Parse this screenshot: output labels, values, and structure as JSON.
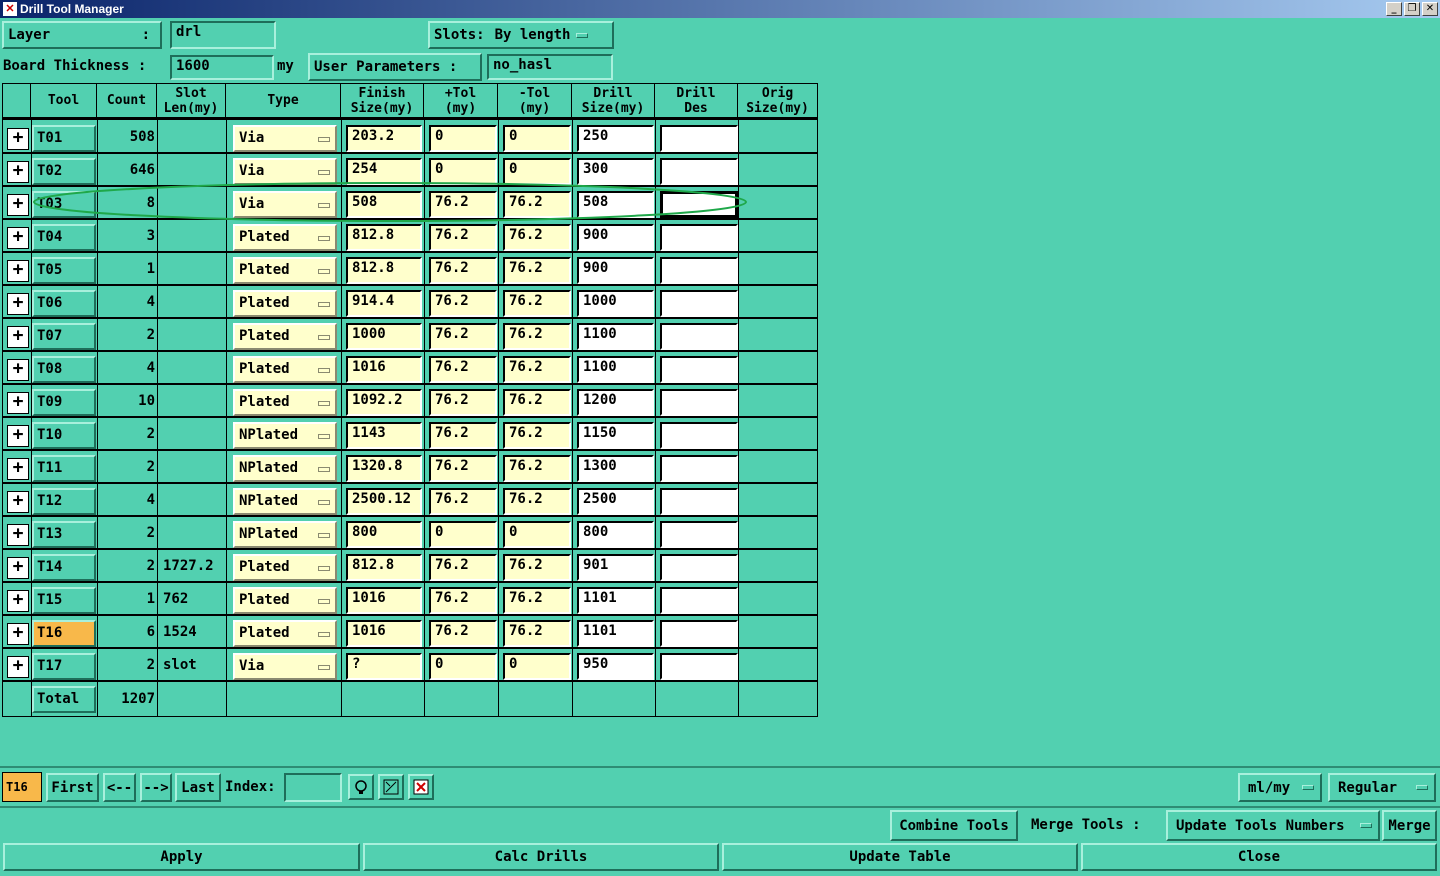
{
  "window": {
    "title": "Drill Tool Manager"
  },
  "top": {
    "layer_label": "Layer",
    "layer_colon": ":",
    "layer_value": "drl",
    "slots_label": "Slots:",
    "slots_value": "By length",
    "board_thickness_label": "Board Thickness :",
    "board_thickness_value": "1600",
    "board_thickness_unit": "my",
    "user_params_label": "User Parameters :",
    "user_params_value": "no_hasl"
  },
  "table": {
    "headers": {
      "tool": "Tool",
      "count": "Count",
      "slot1": "Slot",
      "slot2": "Len(my)",
      "type": "Type",
      "finish1": "Finish",
      "finish2": "Size(my)",
      "ptol1": "+Tol",
      "ptol2": "(my)",
      "mtol1": "-Tol",
      "mtol2": "(my)",
      "drill1": "Drill",
      "drill2": "Size(my)",
      "des1": "Drill",
      "des2": "Des",
      "orig1": "Orig",
      "orig2": "Size(my)"
    },
    "rows": [
      {
        "tool": "T01",
        "count": "508",
        "slot": "",
        "type": "Via",
        "finish": "203.2",
        "ptol": "0",
        "mtol": "0",
        "drill": "250",
        "des": ""
      },
      {
        "tool": "T02",
        "count": "646",
        "slot": "",
        "type": "Via",
        "finish": "254",
        "ptol": "0",
        "mtol": "0",
        "drill": "300",
        "des": ""
      },
      {
        "tool": "T03",
        "count": "8",
        "slot": "",
        "type": "Via",
        "finish": "508",
        "ptol": "76.2",
        "mtol": "76.2",
        "drill": "508",
        "des": ""
      },
      {
        "tool": "T04",
        "count": "3",
        "slot": "",
        "type": "Plated",
        "finish": "812.8",
        "ptol": "76.2",
        "mtol": "76.2",
        "drill": "900",
        "des": ""
      },
      {
        "tool": "T05",
        "count": "1",
        "slot": "",
        "type": "Plated",
        "finish": "812.8",
        "ptol": "76.2",
        "mtol": "76.2",
        "drill": "900",
        "des": ""
      },
      {
        "tool": "T06",
        "count": "4",
        "slot": "",
        "type": "Plated",
        "finish": "914.4",
        "ptol": "76.2",
        "mtol": "76.2",
        "drill": "1000",
        "des": ""
      },
      {
        "tool": "T07",
        "count": "2",
        "slot": "",
        "type": "Plated",
        "finish": "1000",
        "ptol": "76.2",
        "mtol": "76.2",
        "drill": "1100",
        "des": ""
      },
      {
        "tool": "T08",
        "count": "4",
        "slot": "",
        "type": "Plated",
        "finish": "1016",
        "ptol": "76.2",
        "mtol": "76.2",
        "drill": "1100",
        "des": ""
      },
      {
        "tool": "T09",
        "count": "10",
        "slot": "",
        "type": "Plated",
        "finish": "1092.2",
        "ptol": "76.2",
        "mtol": "76.2",
        "drill": "1200",
        "des": ""
      },
      {
        "tool": "T10",
        "count": "2",
        "slot": "",
        "type": "NPlated",
        "finish": "1143",
        "ptol": "76.2",
        "mtol": "76.2",
        "drill": "1150",
        "des": ""
      },
      {
        "tool": "T11",
        "count": "2",
        "slot": "",
        "type": "NPlated",
        "finish": "1320.8",
        "ptol": "76.2",
        "mtol": "76.2",
        "drill": "1300",
        "des": ""
      },
      {
        "tool": "T12",
        "count": "4",
        "slot": "",
        "type": "NPlated",
        "finish": "2500.12",
        "ptol": "76.2",
        "mtol": "76.2",
        "drill": "2500",
        "des": ""
      },
      {
        "tool": "T13",
        "count": "2",
        "slot": "",
        "type": "NPlated",
        "finish": "800",
        "ptol": "0",
        "mtol": "0",
        "drill": "800",
        "des": ""
      },
      {
        "tool": "T14",
        "count": "2",
        "slot": "1727.2",
        "type": "Plated",
        "finish": "812.8",
        "ptol": "76.2",
        "mtol": "76.2",
        "drill": "901",
        "des": ""
      },
      {
        "tool": "T15",
        "count": "1",
        "slot": "762",
        "type": "Plated",
        "finish": "1016",
        "ptol": "76.2",
        "mtol": "76.2",
        "drill": "1101",
        "des": ""
      },
      {
        "tool": "T16",
        "count": "6",
        "slot": "1524",
        "type": "Plated",
        "finish": "1016",
        "ptol": "76.2",
        "mtol": "76.2",
        "drill": "1101",
        "des": ""
      },
      {
        "tool": "T17",
        "count": "2",
        "slot": "slot",
        "type": "Via",
        "finish": "?",
        "ptol": "0",
        "mtol": "0",
        "drill": "950",
        "des": ""
      }
    ],
    "total_label": "Total",
    "total_count": "1207"
  },
  "nav": {
    "current_tool": "T16",
    "first": "First",
    "prev": "<--",
    "next": "-->",
    "last": "Last",
    "index_label": "Index:",
    "index_value": "",
    "units": "ml/my",
    "mode": "Regular"
  },
  "bottom": {
    "combine_tools": "Combine Tools",
    "merge_tools_label": "Merge Tools :",
    "merge_option": "Update Tools Numbers",
    "merge": "Merge",
    "apply": "Apply",
    "calc_drills": "Calc Drills",
    "update_table": "Update Table",
    "close": "Close"
  },
  "colors": {
    "background": "#52d0b0",
    "input_bg": "#ffffcc",
    "selected_tool": "#f8b84a",
    "annotation": "#1fa84a"
  }
}
